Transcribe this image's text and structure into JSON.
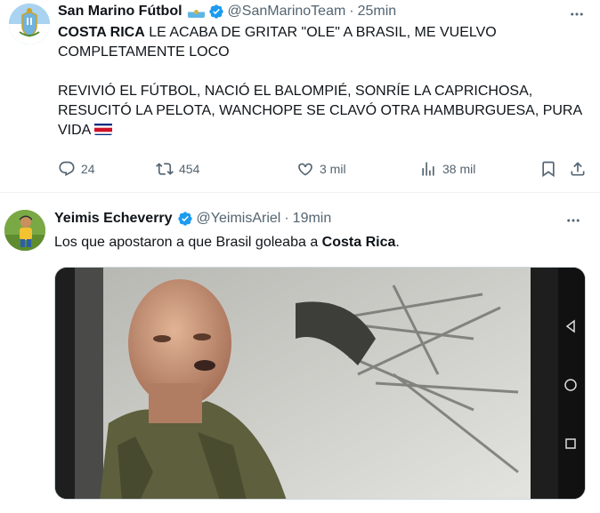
{
  "tweet1": {
    "author_name": "San Marino Fútbol",
    "handle": "@SanMarinoTeam",
    "separator": "·",
    "time": "25min",
    "text_bold": "COSTA RICA",
    "text_line1_rest": " LE ACABA DE GRITAR \"OLE\" A BRASIL, ME VUELVO COMPLETAMENTE LOCO",
    "text_para2": "REVIVIÓ EL FÚTBOL, NACIÓ EL BALOMPIÉ, SONRÍE LA CAPRICHOSA, RESUCITÓ LA PELOTA, WANCHOPE SE CLAVÓ OTRA HAMBURGUESA, PURA VIDA",
    "replies": "24",
    "retweets": "454",
    "likes": "3 mil",
    "views": "38 mil"
  },
  "tweet2": {
    "author_name": "Yeimis Echeverry",
    "handle": "@YeimisAriel",
    "separator": "·",
    "time": "19min",
    "text_prefix": "Los que apostaron a que Brasil goleaba a ",
    "text_bold": "Costa Rica",
    "text_suffix": "."
  },
  "icons": [
    "more-icon",
    "verified-icon",
    "reply-icon",
    "retweet-icon",
    "like-icon",
    "views-icon",
    "bookmark-icon",
    "share-icon",
    "android-back-icon",
    "android-home-icon",
    "android-recents-icon"
  ],
  "colors": {
    "text": "#0f1419",
    "secondary": "#536471",
    "verified": "#1d9bf0",
    "divider": "#eff3f4"
  }
}
